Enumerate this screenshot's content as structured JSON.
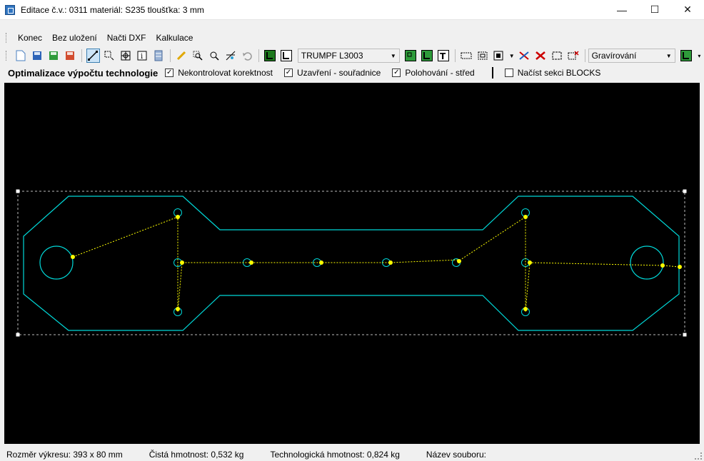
{
  "window": {
    "title": "Editace č.v.: 0311   materiál: S235   tloušťka: 3 mm",
    "minimize_glyph": "—",
    "maximize_glyph": "☐",
    "close_glyph": "✕"
  },
  "menu": {
    "items": [
      "Konec",
      "Bez uložení",
      "Načti DXF",
      "Kalkulace"
    ]
  },
  "toolbar": {
    "machine": "TRUMPF L3003",
    "layer": "Gravírování",
    "icons": [
      "new-file-icon",
      "save-icon",
      "save-green-icon",
      "save-red-icon",
      "line-tool-icon",
      "select-icon",
      "target-icon",
      "info-icon",
      "stack-icon",
      "pencil-icon",
      "zoom-icon",
      "zoom-window-icon",
      "trim-icon",
      "undo-icon",
      "corner-icon",
      "corner-outline-icon"
    ]
  },
  "options": {
    "title": "Optimalizace výpočtu technologie",
    "checkboxes": [
      {
        "label": "Nekontrolovat korektnost",
        "checked": true
      },
      {
        "label": "Uzavření - souřadnice",
        "checked": true
      },
      {
        "label": "Polohování - střed",
        "checked": true
      }
    ],
    "blocks": {
      "label": "Načíst sekci BLOCKS",
      "checked": false
    }
  },
  "status": {
    "size": "Rozměr výkresu: 393 x 80 mm",
    "net_weight": "Čistá hmotnost: 0,532 kg",
    "tech_weight": "Technologická hmotnost: 0,824 kg",
    "filename": "Název souboru:"
  },
  "colors": {
    "contour": "#00d8d8",
    "path": "#ffff00",
    "canvas_bg": "#000000"
  }
}
